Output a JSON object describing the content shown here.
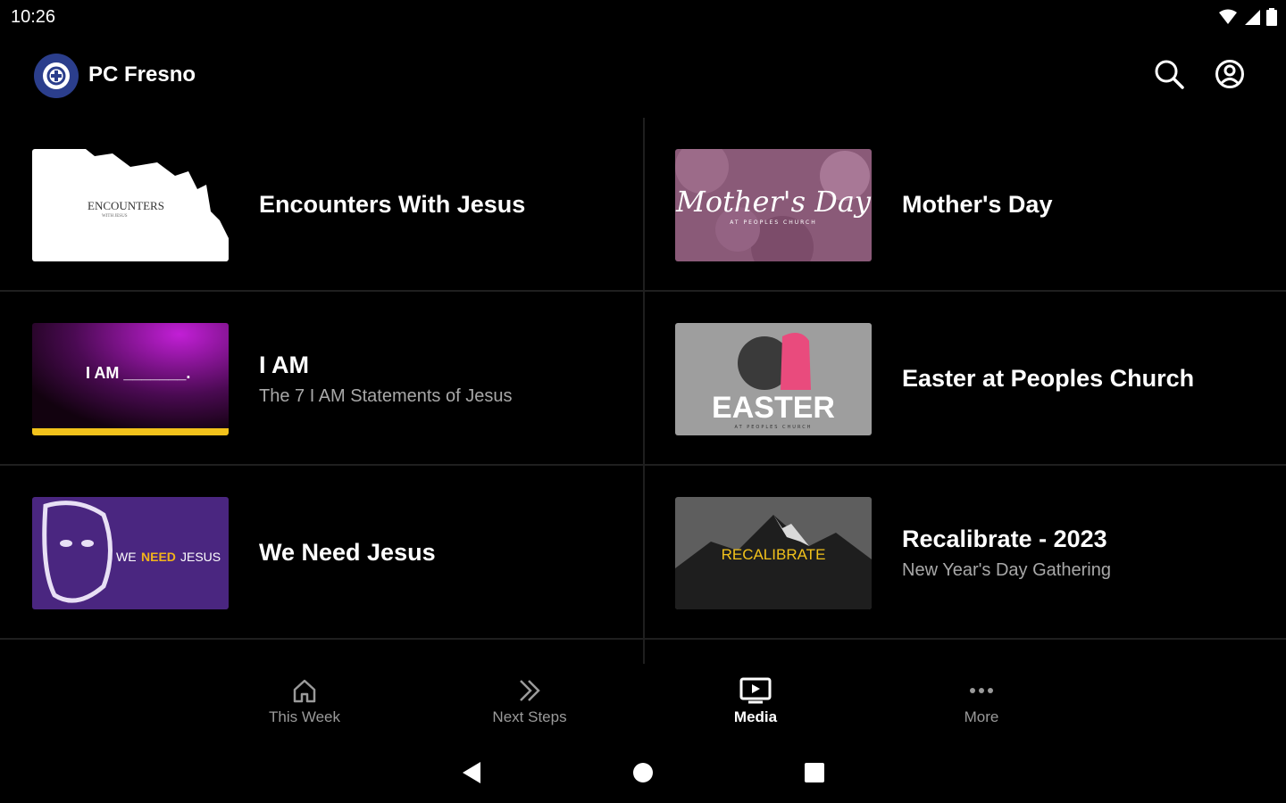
{
  "status_bar": {
    "time": "10:26",
    "icons": [
      "wifi-icon",
      "signal-icon",
      "battery-icon"
    ]
  },
  "app_bar": {
    "title": "PC Fresno",
    "logo_icon": "church-logo-icon",
    "actions": [
      "search-icon",
      "account-icon"
    ]
  },
  "series": [
    {
      "title": "Encounters With Jesus",
      "subtitle": "",
      "thumb_text": "ENCOUNTERS",
      "thumb_subtext": "WITH JESUS"
    },
    {
      "title": "Mother's Day",
      "subtitle": "",
      "thumb_text": "Mother's Day",
      "thumb_subtext": "AT PEOPLES CHURCH"
    },
    {
      "title": "I AM",
      "subtitle": "The 7 I AM Statements of Jesus",
      "thumb_text": "I AM _______."
    },
    {
      "title": "Easter at Peoples Church",
      "subtitle": "",
      "thumb_text": "EASTER",
      "thumb_subtext": "AT PEOPLES CHURCH"
    },
    {
      "title": "We Need Jesus",
      "subtitle": "",
      "thumb_text_a": "WE",
      "thumb_text_b": "NEED",
      "thumb_text_c": "JESUS"
    },
    {
      "title": "Recalibrate - 2023",
      "subtitle": "New Year's Day Gathering",
      "thumb_text": "RECALIBRATE"
    }
  ],
  "bottom_nav": [
    {
      "label": "This Week",
      "icon": "home-icon",
      "active": false
    },
    {
      "label": "Next Steps",
      "icon": "double-chevron-icon",
      "active": false
    },
    {
      "label": "Media",
      "icon": "media-icon",
      "active": true
    },
    {
      "label": "More",
      "icon": "more-dots-icon",
      "active": false
    }
  ],
  "colors": {
    "background": "#000000",
    "divider": "#1f1f1f",
    "text_secondary": "#a8a8a8",
    "logo_blue": "#2b3e8c"
  }
}
